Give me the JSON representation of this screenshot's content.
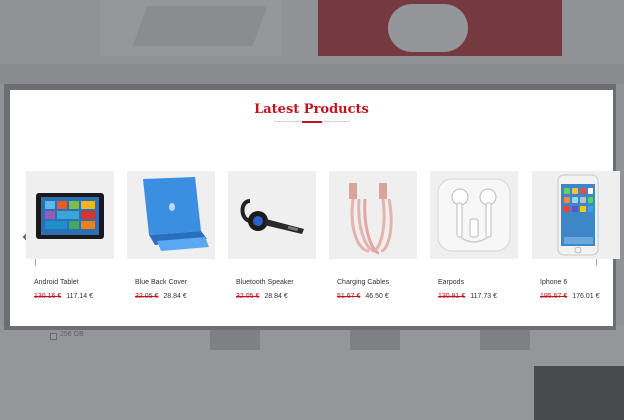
{
  "background": {
    "filter_option": "256 GB"
  },
  "modal": {
    "title": "Latest Products",
    "prev_label": "‹",
    "next_label": "›"
  },
  "products": [
    {
      "name": "Android Tablet",
      "old_price": "130.16 €",
      "new_price": "117.14 €",
      "icon": "tablet-image"
    },
    {
      "name": "Blue Back Cover",
      "old_price": "32.05 €",
      "new_price": "28.84 €",
      "icon": "tablet-cover-image"
    },
    {
      "name": "Bluetooth Speaker",
      "old_price": "32.05 €",
      "new_price": "28.84 €",
      "icon": "bluetooth-headset-image"
    },
    {
      "name": "Charging Cables",
      "old_price": "51.67 €",
      "new_price": "46.50 €",
      "icon": "charging-cable-image"
    },
    {
      "name": "Earpods",
      "old_price": "130.81 €",
      "new_price": "117.73 €",
      "icon": "earpods-image"
    },
    {
      "name": "Iphone 6",
      "old_price": "195.57 €",
      "new_price": "176.01 €",
      "icon": "iphone-image"
    }
  ],
  "colors": {
    "accent": "#c2141f",
    "overlay": "#373a3f"
  }
}
